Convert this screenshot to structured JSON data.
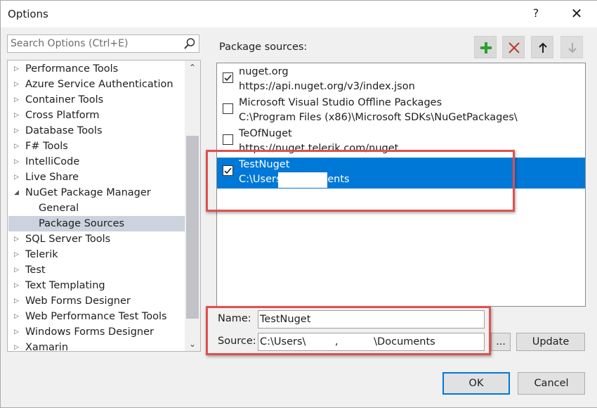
{
  "window": {
    "title": "Options",
    "help": "?",
    "close": "✕"
  },
  "search": {
    "placeholder": "Search Options (Ctrl+E)"
  },
  "tree": {
    "items": [
      {
        "label": "Performance Tools",
        "arrow": "▷"
      },
      {
        "label": "Azure Service Authentication",
        "arrow": "▷"
      },
      {
        "label": "Container Tools",
        "arrow": "▷"
      },
      {
        "label": "Cross Platform",
        "arrow": "▷"
      },
      {
        "label": "Database Tools",
        "arrow": "▷"
      },
      {
        "label": "F# Tools",
        "arrow": "▷"
      },
      {
        "label": "IntelliCode",
        "arrow": "▷"
      },
      {
        "label": "Live Share",
        "arrow": "▷"
      },
      {
        "label": "NuGet Package Manager",
        "arrow": "◢"
      },
      {
        "label": "General",
        "arrow": ""
      },
      {
        "label": "Package Sources",
        "arrow": ""
      },
      {
        "label": "SQL Server Tools",
        "arrow": "▷"
      },
      {
        "label": "Telerik",
        "arrow": "▷"
      },
      {
        "label": "Test",
        "arrow": "▷"
      },
      {
        "label": "Text Templating",
        "arrow": "▷"
      },
      {
        "label": "Web Forms Designer",
        "arrow": "▷"
      },
      {
        "label": "Web Performance Test Tools",
        "arrow": "▷"
      },
      {
        "label": "Windows Forms Designer",
        "arrow": "▷"
      },
      {
        "label": "Xamarin",
        "arrow": "▷"
      }
    ],
    "selected": "Package Sources",
    "scroll_up": "⌃",
    "scroll_down": "⌄"
  },
  "sources": {
    "label": "Package sources:",
    "items": [
      {
        "name": "nuget.org",
        "url": "https://api.nuget.org/v3/index.json",
        "checked": true
      },
      {
        "name": "Microsoft Visual Studio Offline Packages",
        "url": "C:\\Program Files (x86)\\Microsoft SDKs\\NuGetPackages\\",
        "checked": false
      },
      {
        "name": "TeOfNuget",
        "url": "https://nuget.telerik.com/nuget",
        "checked": false
      },
      {
        "name": "TestNuget",
        "url": "C:\\Users\\                  \\Documents",
        "checked": true
      }
    ]
  },
  "form": {
    "name_label": "Name:",
    "name_value": "TestNuget",
    "source_label": "Source:",
    "source_value": "C:\\Users\\         ,           \\Documents",
    "browse_label": "...",
    "update_label": "Update"
  },
  "buttons": {
    "ok": "OK",
    "cancel": "Cancel"
  },
  "colors": {
    "selection": "#0078d7",
    "highlight_box": "#e05050",
    "add": "#2ca02c",
    "remove": "#c0392b"
  }
}
